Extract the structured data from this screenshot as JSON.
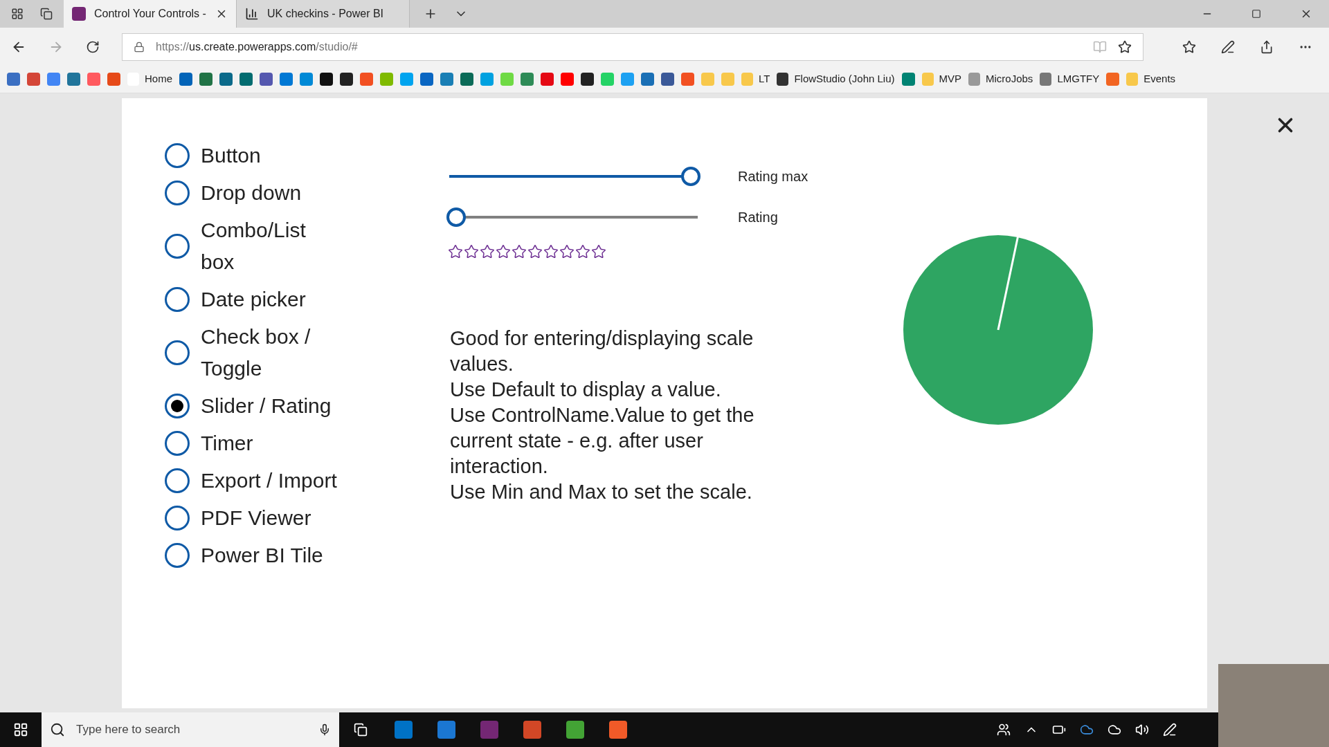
{
  "tabs": [
    {
      "title": "Control Your Controls -",
      "selected": true
    },
    {
      "title": "UK checkins - Power BI",
      "selected": false
    }
  ],
  "address": {
    "host": "us.create.powerapps.com",
    "scheme": "https://",
    "path": "/studio/#"
  },
  "bookmarks": [
    {
      "kind": "icon",
      "color": "#3b6fc2"
    },
    {
      "kind": "icon",
      "color": "#d44638"
    },
    {
      "kind": "icon",
      "color": "#4285f4"
    },
    {
      "kind": "icon",
      "color": "#21759b"
    },
    {
      "kind": "icon",
      "color": "#ff5a5f"
    },
    {
      "kind": "icon",
      "color": "#e64a19"
    },
    {
      "kind": "labeled",
      "label": "Home",
      "color": "#ffffff"
    },
    {
      "kind": "icon",
      "color": "#0364b8"
    },
    {
      "kind": "icon",
      "color": "#217346"
    },
    {
      "kind": "icon",
      "color": "#0b6a8a"
    },
    {
      "kind": "icon",
      "color": "#036c70"
    },
    {
      "kind": "icon",
      "color": "#5558af"
    },
    {
      "kind": "icon",
      "color": "#0078d4"
    },
    {
      "kind": "icon",
      "color": "#0089d6"
    },
    {
      "kind": "icon",
      "color": "#111111"
    },
    {
      "kind": "icon",
      "color": "#222222"
    },
    {
      "kind": "icon",
      "color": "#f25022"
    },
    {
      "kind": "icon",
      "color": "#7fba00"
    },
    {
      "kind": "icon",
      "color": "#00a4ef"
    },
    {
      "kind": "icon",
      "color": "#0a66c2"
    },
    {
      "kind": "icon",
      "color": "#1a7fb5"
    },
    {
      "kind": "icon",
      "color": "#0c6b58"
    },
    {
      "kind": "icon",
      "color": "#00a1e0"
    },
    {
      "kind": "icon",
      "color": "#6fda44"
    },
    {
      "kind": "icon",
      "color": "#2e8b57"
    },
    {
      "kind": "icon",
      "color": "#e50914"
    },
    {
      "kind": "icon",
      "color": "#ff0000"
    },
    {
      "kind": "icon",
      "color": "#222222"
    },
    {
      "kind": "icon",
      "color": "#25d366"
    },
    {
      "kind": "icon",
      "color": "#1da1f2"
    },
    {
      "kind": "icon",
      "color": "#1a6fb5"
    },
    {
      "kind": "icon",
      "color": "#3b5998"
    },
    {
      "kind": "icon",
      "color": "#f25022"
    },
    {
      "kind": "icon",
      "color": "#f8c84b"
    },
    {
      "kind": "icon",
      "color": "#f8c84b"
    },
    {
      "kind": "labeled",
      "label": "LT",
      "color": "#f8c84b"
    },
    {
      "kind": "labeled",
      "label": "FlowStudio (John Liu)",
      "color": "#333333"
    },
    {
      "kind": "icon",
      "color": "#008373"
    },
    {
      "kind": "labeled",
      "label": "MVP",
      "color": "#f8c84b"
    },
    {
      "kind": "labeled",
      "label": "MicroJobs",
      "color": "#999999"
    },
    {
      "kind": "labeled",
      "label": "LMGTFY",
      "color": "#777777"
    },
    {
      "kind": "icon",
      "color": "#f26522"
    },
    {
      "kind": "labeled",
      "label": "Events",
      "color": "#f8c84b"
    }
  ],
  "options": [
    {
      "label": "Button",
      "selected": false
    },
    {
      "label": "Drop down",
      "selected": false
    },
    {
      "label": "Combo/List box",
      "selected": false
    },
    {
      "label": "Date picker",
      "selected": false
    },
    {
      "label": "Check box / Toggle",
      "selected": false
    },
    {
      "label": "Slider / Rating",
      "selected": true
    },
    {
      "label": "Timer",
      "selected": false
    },
    {
      "label": "Export / Import",
      "selected": false
    },
    {
      "label": "PDF Viewer",
      "selected": false
    },
    {
      "label": "Power BI Tile",
      "selected": false
    }
  ],
  "sliders": [
    {
      "label": "Rating max",
      "level": 1
    },
    {
      "label": "Rating",
      "level": 0
    }
  ],
  "rating": {
    "stars": 0
  },
  "description": [
    "Good for entering/displaying scale values.",
    "Use Default to display a value.",
    "Use ControlName.Value to get the current state - e.g. after user interaction.",
    "Use Min and Max to set the scale."
  ],
  "taskbar": {
    "search_placeholder": "Type here to search"
  }
}
